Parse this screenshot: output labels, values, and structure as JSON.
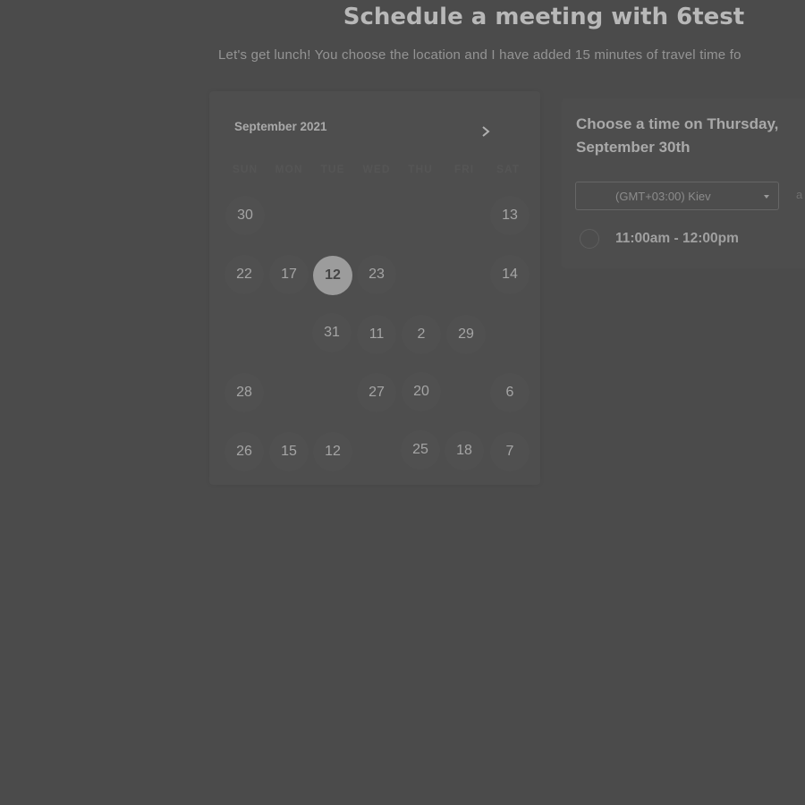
{
  "header": {
    "title": "Schedule a meeting with 6test",
    "subtitle": "Let's get lunch! You choose the location and I have added 15 minutes of travel time fo"
  },
  "calendar": {
    "month_label": "September 2021",
    "next_icon": "chevron-right-icon",
    "weekdays": [
      "SUN",
      "MON",
      "TUE",
      "WED",
      "THU",
      "FRI",
      "SAT"
    ],
    "selected_day": "12",
    "days": {
      "r1_sun": "30",
      "r1_sat": "13",
      "r2_sun": "22",
      "r2_mon": "17",
      "r2_tue": "12",
      "r2_wed": "23",
      "r2_fri": "",
      "r2_sat": "14",
      "r3_tue": "31",
      "r3_wed": "11",
      "r3_thu": "2",
      "r3_fri": "29",
      "r4_sun": "28",
      "r4_wed": "27",
      "r4_thu": "20",
      "r4_sat": "6",
      "r5_sun": "26",
      "r5_mon": "15",
      "r5_tue": "12",
      "r5_thu": "25",
      "r5_fri": "18",
      "r5_sat": "7"
    }
  },
  "time_picker": {
    "heading": "Choose a time on Thursday, September 30th",
    "timezone": "(GMT+03:00) Kiev",
    "timezone_caret_icon": "caret-down-icon",
    "side_text": "a",
    "slots": [
      {
        "label": "11:00am - 12:00pm"
      }
    ]
  }
}
